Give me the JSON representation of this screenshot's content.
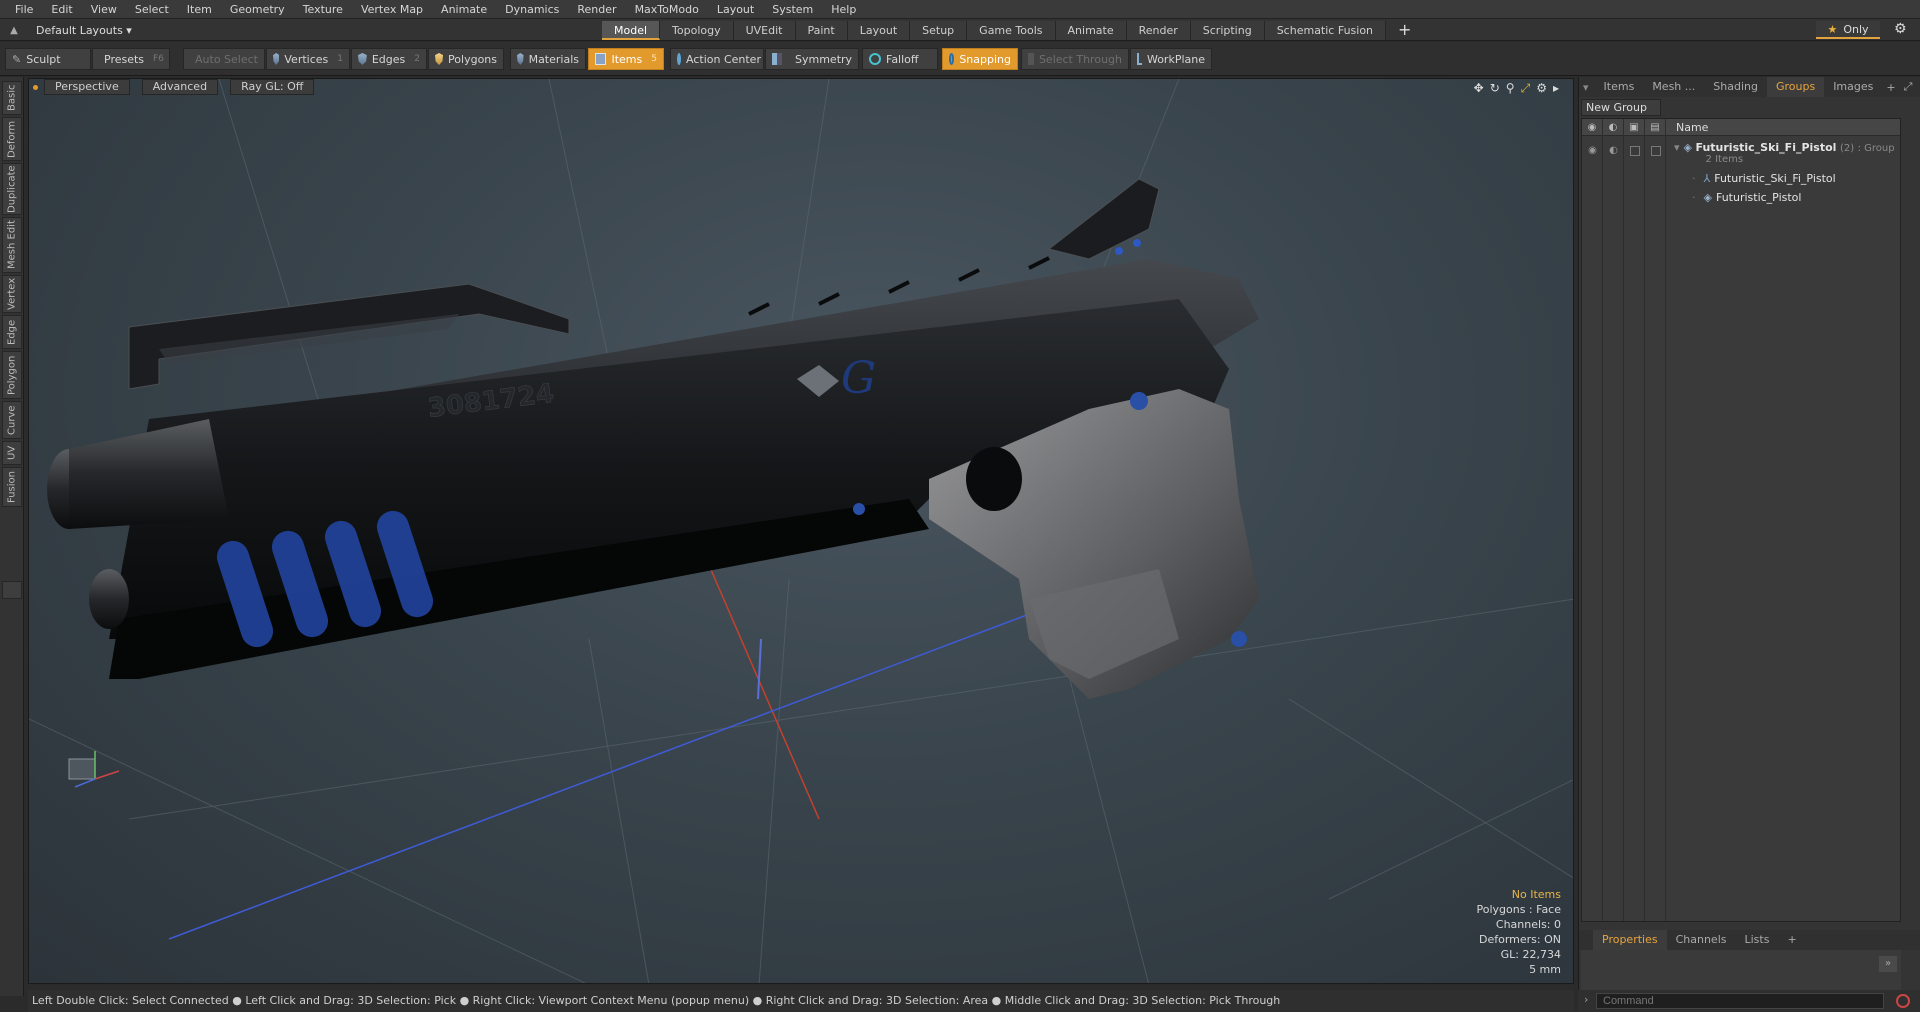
{
  "menu": [
    "File",
    "Edit",
    "View",
    "Select",
    "Item",
    "Geometry",
    "Texture",
    "Vertex Map",
    "Animate",
    "Dynamics",
    "Render",
    "MaxToModo",
    "Layout",
    "System",
    "Help"
  ],
  "layouts": {
    "label": "Default Layouts ▾"
  },
  "tabs": [
    "Model",
    "Topology",
    "UVEdit",
    "Paint",
    "Layout",
    "Setup",
    "Game Tools",
    "Animate",
    "Render",
    "Scripting",
    "Schematic Fusion",
    "+"
  ],
  "only": {
    "label": "Only"
  },
  "toolbar": {
    "sculpt": "Sculpt",
    "presets": "Presets",
    "presets_key": "F6",
    "auto_select": "Auto Select",
    "vertices": "Vertices",
    "vertices_n": "1",
    "edges": "Edges",
    "edges_n": "2",
    "polygons": "Polygons",
    "materials": "Materials",
    "items": "Items",
    "items_n": "5",
    "action_center": "Action Center",
    "symmetry": "Symmetry",
    "falloff": "Falloff",
    "snapping": "Snapping",
    "select_through": "Select Through",
    "workplane": "WorkPlane"
  },
  "left_tabs": [
    "Basic",
    "Deform",
    "Duplicate",
    "Mesh Edit",
    "Vertex",
    "Edge",
    "Polygon",
    "Curve",
    "UV",
    "Fusion"
  ],
  "viewport": {
    "perspective": "Perspective",
    "advanced": "Advanced",
    "raygl": "Ray GL: Off",
    "serial": "3081724",
    "info": [
      "No Items",
      "Polygons : Face",
      "Channels: 0",
      "Deformers: ON",
      "GL: 22,734",
      "5 mm"
    ]
  },
  "right": {
    "tabs": [
      "Items",
      "Mesh ...",
      "Shading",
      "Groups",
      "Images"
    ],
    "new_group": "New Group",
    "col_name": "Name",
    "group_name": "Futuristic_Ski_Fi_Pistol",
    "group_count": "(2)",
    "group_type": ": Group",
    "group_sub": "2 Items",
    "child1": "Futuristic_Ski_Fi_Pistol",
    "child2": "Futuristic_Pistol",
    "bottom_tabs": [
      "Properties",
      "Channels",
      "Lists",
      "+"
    ]
  },
  "status": "Left Double Click: Select Connected ● Left Click and Drag: 3D Selection: Pick ● Right Click: Viewport Context Menu (popup menu) ● Right Click and Drag: 3D Selection: Area ● Middle Click and Drag: 3D Selection: Pick Through",
  "command": {
    "placeholder": "Command"
  },
  "colors": {
    "accent": "#e39a2d",
    "pistol_glow": "#2a55b8"
  }
}
